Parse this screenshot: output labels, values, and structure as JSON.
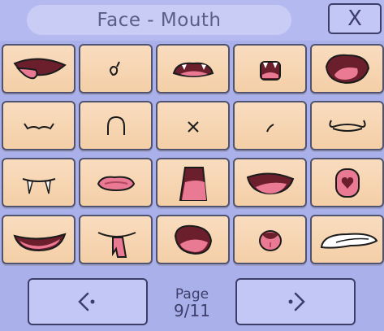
{
  "header": {
    "title": "Face - Mouth",
    "close_label": "X"
  },
  "colors": {
    "tile_fill": "#f4cfa7",
    "tile_border": "#50536f",
    "panel": "#aab0ea",
    "button": "#c3c7f5",
    "mouth_dark": "#6b1f2c",
    "tongue_pink": "#ea7a93"
  },
  "mouths": [
    {
      "name": "mouth-tongue-out"
    },
    {
      "name": "mouth-tiny-o"
    },
    {
      "name": "mouth-fang-grin"
    },
    {
      "name": "mouth-open-fangs"
    },
    {
      "name": "mouth-big-shout"
    },
    {
      "name": "mouth-cat-smile"
    },
    {
      "name": "mouth-frown-arch"
    },
    {
      "name": "mouth-x"
    },
    {
      "name": "mouth-small-line"
    },
    {
      "name": "mouth-wavy-grin"
    },
    {
      "name": "mouth-fangs-only"
    },
    {
      "name": "mouth-pink-pout"
    },
    {
      "name": "mouth-trapezoid-open"
    },
    {
      "name": "mouth-wide-open"
    },
    {
      "name": "mouth-heart-o"
    },
    {
      "name": "mouth-flat-smile"
    },
    {
      "name": "mouth-tongue-tab"
    },
    {
      "name": "mouth-blob-open"
    },
    {
      "name": "mouth-o-tongue"
    },
    {
      "name": "mouth-white-grin"
    }
  ],
  "pager": {
    "label": "Page",
    "current": "9/11"
  }
}
